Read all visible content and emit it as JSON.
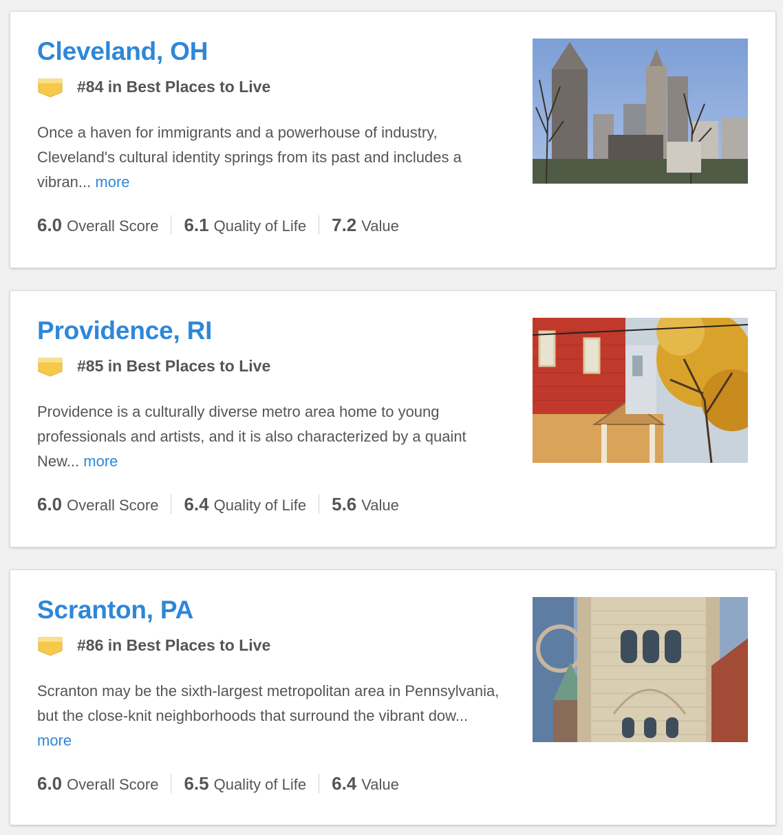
{
  "accent_color": "#2e87d8",
  "badge_color": "#f6c94a",
  "cards": [
    {
      "city": "Cleveland, OH",
      "rank": "#84 in Best Places to Live",
      "description": "Once a haven for immigrants and a powerhouse of industry, Cleveland's cultural identity springs from its past and includes a vibran...",
      "more": "more",
      "scores": [
        {
          "value": "6.0",
          "label": "Overall Score"
        },
        {
          "value": "6.1",
          "label": "Quality of Life"
        },
        {
          "value": "7.2",
          "label": "Value"
        }
      ]
    },
    {
      "city": "Providence, RI",
      "rank": "#85 in Best Places to Live",
      "description": "Providence is a culturally diverse metro area home to young professionals and artists, and it is also characterized by a quaint New...",
      "more": "more",
      "scores": [
        {
          "value": "6.0",
          "label": "Overall Score"
        },
        {
          "value": "6.4",
          "label": "Quality of Life"
        },
        {
          "value": "5.6",
          "label": "Value"
        }
      ]
    },
    {
      "city": "Scranton, PA",
      "rank": "#86 in Best Places to Live",
      "description": "Scranton may be the sixth-largest metropolitan area in Pennsylvania, but the close-knit neighborhoods that surround the vibrant dow...",
      "more": "more",
      "scores": [
        {
          "value": "6.0",
          "label": "Overall Score"
        },
        {
          "value": "6.5",
          "label": "Quality of Life"
        },
        {
          "value": "6.4",
          "label": "Value"
        }
      ]
    }
  ]
}
